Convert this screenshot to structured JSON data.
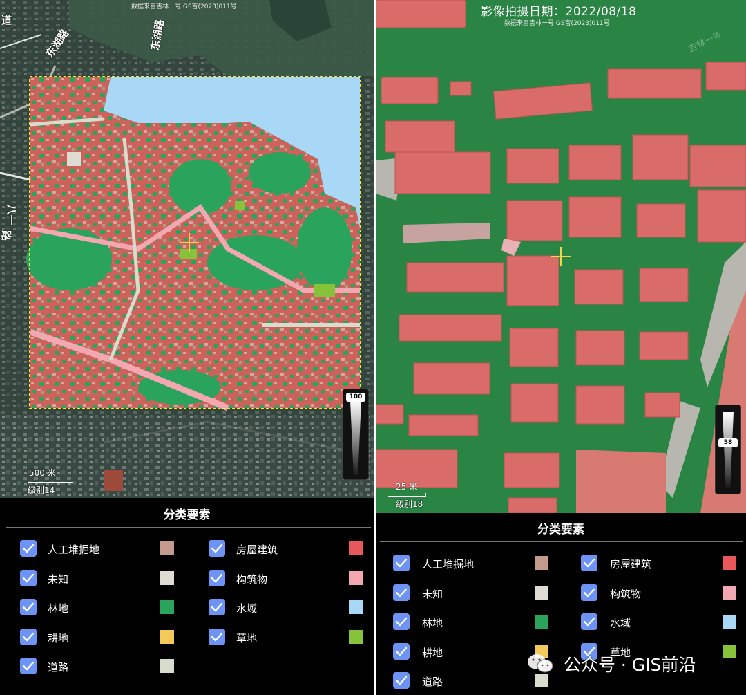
{
  "left": {
    "attribution": "数据来自吉林一号 GS吉(2023)011号",
    "road_labels": [
      "东湖路",
      "东湖路",
      "道",
      "路",
      "八一"
    ],
    "scale": {
      "distance": "500 米",
      "level": "级别14"
    },
    "opacity": "100",
    "legend_title": "分类要素"
  },
  "right": {
    "capture_date": "影像拍摄日期：2022/08/18",
    "attribution": "数据来自吉林一号 GS吉(2023)011号",
    "watermark": "吉林一号",
    "scale": {
      "distance": "25 米",
      "level": "级别18"
    },
    "opacity": "58",
    "legend_title": "分类要素"
  },
  "legend": [
    {
      "label": "人工堆掘地",
      "color": "#c49a8c",
      "checked": true
    },
    {
      "label": "房屋建筑",
      "color": "#e8575a",
      "checked": true
    },
    {
      "label": "未知",
      "color": "#dedbd2",
      "checked": true
    },
    {
      "label": "构筑物",
      "color": "#f2a7b1",
      "checked": true
    },
    {
      "label": "林地",
      "color": "#2aa35c",
      "checked": true
    },
    {
      "label": "水域",
      "color": "#a9d8f6",
      "checked": true
    },
    {
      "label": "耕地",
      "color": "#f3c95a",
      "checked": true
    },
    {
      "label": "草地",
      "color": "#86c23a",
      "checked": true
    },
    {
      "label": "道路",
      "color": "#d8dccd",
      "checked": true
    }
  ],
  "watermark": {
    "text": "公众号 · GIS前沿"
  },
  "icons": {
    "checkbox": "checkmark-icon",
    "crosshair": "crosshair-icon",
    "wechat": "wechat-icon"
  }
}
